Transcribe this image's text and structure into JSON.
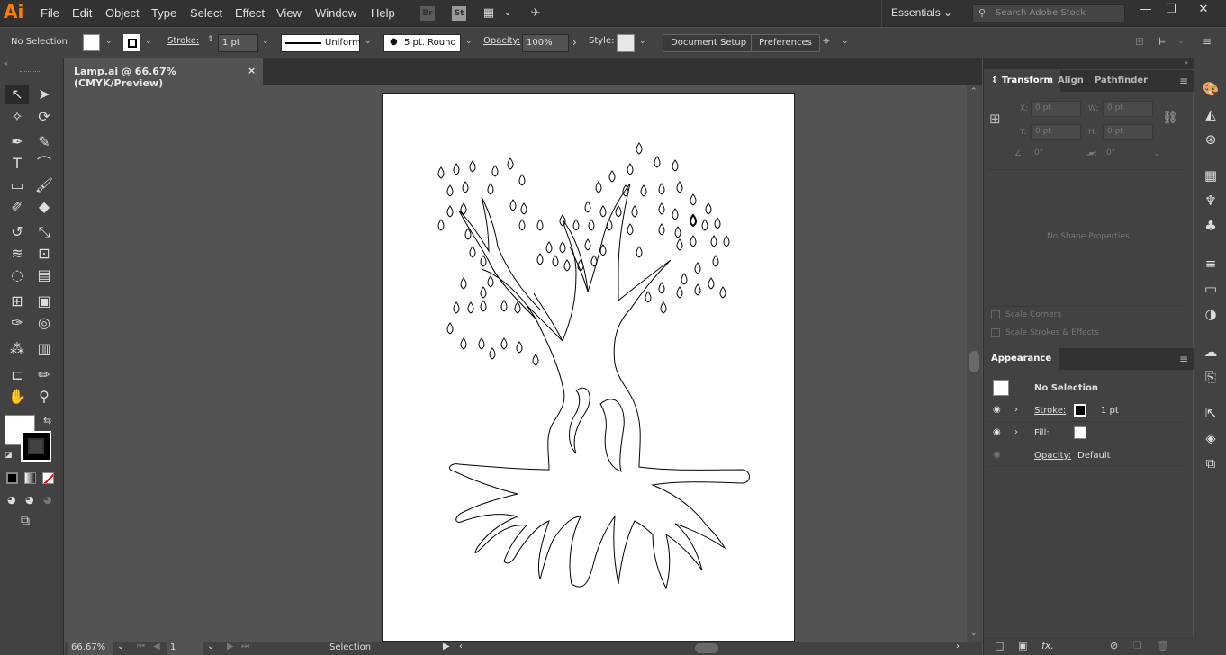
{
  "app": {
    "logo": "Ai"
  },
  "menu": [
    "File",
    "Edit",
    "Object",
    "Type",
    "Select",
    "Effect",
    "View",
    "Window",
    "Help"
  ],
  "menubar_icons": {
    "bridge": "Br",
    "stock": "St"
  },
  "workspace": "Essentials",
  "search": {
    "placeholder": "Search Adobe Stock"
  },
  "control": {
    "selection": "No Selection",
    "stroke_label": "Stroke:",
    "stroke_value": "1 pt",
    "profile": "Uniform",
    "brush": "5 pt. Round",
    "opacity_label": "Opacity:",
    "opacity_value": "100%",
    "style_label": "Style:",
    "doc_setup": "Document Setup",
    "preferences": "Preferences"
  },
  "document": {
    "tab": "Lamp.ai @ 66.67% (CMYK/Preview)",
    "close": "×"
  },
  "status": {
    "zoom": "66.67%",
    "page": "1",
    "tool": "Selection"
  },
  "transform": {
    "tabs": [
      "Transform",
      "Align",
      "Pathfinder"
    ],
    "x": "0 pt",
    "y": "0 pt",
    "w": "0 pt",
    "h": "0 pt",
    "angle": "0°",
    "shear": "0°",
    "x_label": "X:",
    "y_label": "Y:",
    "w_label": "W:",
    "h_label": "H:",
    "no_shape": "No Shape Properties",
    "scale_corners": "Scale Corners",
    "scale_strokes": "Scale Strokes & Effects"
  },
  "appearance": {
    "tab": "Appearance",
    "title": "No Selection",
    "stroke_label": "Stroke:",
    "stroke_value": "1 pt",
    "fill_label": "Fill:",
    "opacity_label": "Opacity:",
    "opacity_value": "Default"
  }
}
